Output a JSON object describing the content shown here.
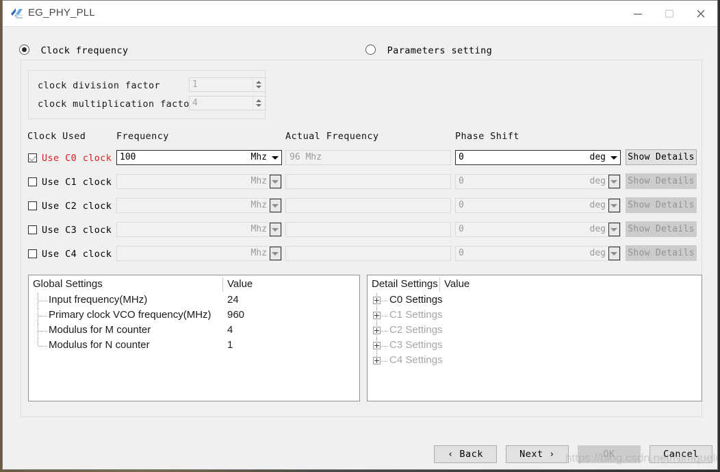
{
  "window": {
    "title": "EG_PHY_PLL",
    "logo_icon": "app-logo-icon",
    "minimize_icon": "minimize-icon",
    "maximize_icon": "maximize-icon",
    "close_icon": "close-icon"
  },
  "mode": {
    "clock_frequency_label": "Clock frequency",
    "clock_frequency_selected": true,
    "parameters_setting_label": "Parameters setting",
    "parameters_setting_selected": false
  },
  "factors": {
    "division_label": "clock division factor",
    "division_value": "1",
    "multiplication_label": "clock multiplication factor",
    "multiplication_value": "4"
  },
  "table": {
    "headers": {
      "clock_used": "Clock Used",
      "frequency": "Frequency",
      "actual_frequency": "Actual Frequency",
      "phase_shift": "Phase Shift"
    },
    "details_button_label": "Show Details",
    "rows": [
      {
        "checkbox_label": "Use C0 clock",
        "checked": true,
        "frequency_value": "100",
        "frequency_unit": "Mhz",
        "actual_frequency": "96 Mhz",
        "phase_value": "0",
        "phase_unit": "deg",
        "enabled": true
      },
      {
        "checkbox_label": "Use C1 clock",
        "checked": false,
        "frequency_value": "",
        "frequency_unit": "Mhz",
        "actual_frequency": "",
        "phase_value": "0",
        "phase_unit": "deg",
        "enabled": false
      },
      {
        "checkbox_label": "Use C2 clock",
        "checked": false,
        "frequency_value": "",
        "frequency_unit": "Mhz",
        "actual_frequency": "",
        "phase_value": "0",
        "phase_unit": "deg",
        "enabled": false
      },
      {
        "checkbox_label": "Use C3 clock",
        "checked": false,
        "frequency_value": "",
        "frequency_unit": "Mhz",
        "actual_frequency": "",
        "phase_value": "0",
        "phase_unit": "deg",
        "enabled": false
      },
      {
        "checkbox_label": "Use C4 clock",
        "checked": false,
        "frequency_value": "",
        "frequency_unit": "Mhz",
        "actual_frequency": "",
        "phase_value": "0",
        "phase_unit": "deg",
        "enabled": false
      }
    ]
  },
  "global_settings": {
    "header_name": "Global Settings",
    "header_value": "Value",
    "items": [
      {
        "label": "Input frequency(MHz)",
        "value": "24"
      },
      {
        "label": "Primary clock VCO frequency(MHz)",
        "value": "960"
      },
      {
        "label": "Modulus for M counter",
        "value": "4"
      },
      {
        "label": "Modulus for N counter",
        "value": "1"
      }
    ]
  },
  "detail_settings": {
    "header_name": "Detail Settings",
    "header_value": "Value",
    "items": [
      {
        "label": "C0 Settings",
        "enabled": true
      },
      {
        "label": "C1 Settings",
        "enabled": false
      },
      {
        "label": "C2 Settings",
        "enabled": false
      },
      {
        "label": "C3 Settings",
        "enabled": false
      },
      {
        "label": "C4 Settings",
        "enabled": false
      }
    ]
  },
  "footer": {
    "back_label": "‹  Back",
    "next_label": "Next  ›",
    "ok_label": "OK",
    "cancel_label": "Cancel",
    "watermark": "https://blog.csdn.net/Nimquelote"
  },
  "colors": {
    "accent_red": "#e01b1b",
    "window_bg": "#f0f0f0",
    "titlebar_bg": "#ffffff",
    "disabled_text": "#9a9a9a",
    "tree_border": "#8a9199"
  }
}
